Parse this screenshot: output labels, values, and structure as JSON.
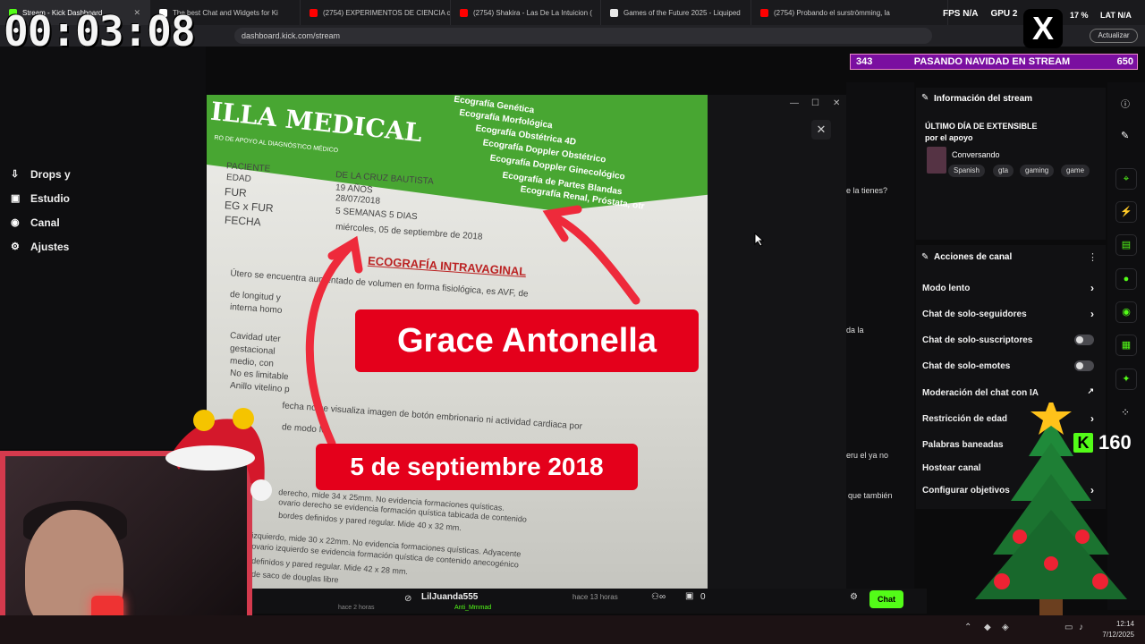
{
  "tabs": [
    {
      "label": "Stream - Kick Dashboard",
      "color": "#53fc18",
      "active": true
    },
    {
      "label": "The best Chat and Widgets for Ki",
      "color": "#ffffff"
    },
    {
      "label": "(2754) EXPERIMENTOS DE CIENCIA c",
      "color": "#ff0000"
    },
    {
      "label": "(2754) Shakira - Las De La Intuicion (",
      "color": "#ff0000"
    },
    {
      "label": "Games of the Future 2025 - Liquiped",
      "color": "#e8e8e8"
    },
    {
      "label": "(2754) Probando el surströmming, la",
      "color": "#ff0000"
    }
  ],
  "address": "dashboard.kick.com/stream",
  "update_label": "Actualizar",
  "timer": "00:03:08",
  "stats": {
    "fps_label": "FPS",
    "fps_value": "N/A",
    "gpu_label": "GPU",
    "gpu_value": "2",
    "load_value": "17 %",
    "lat_label": "LAT",
    "lat_value": "N/A"
  },
  "x_logo": "X",
  "left_nav": [
    {
      "label": "Drops y",
      "icon": "drops-icon"
    },
    {
      "label": "Estudio",
      "icon": "studio-icon"
    },
    {
      "label": "Canal",
      "icon": "channel-icon"
    },
    {
      "label": "Ajustes",
      "icon": "settings-icon"
    }
  ],
  "photo": {
    "clinic_name": "ILLA MEDICAL",
    "clinic_sub": "RO DE APOYO AL DIAGNÓSTICO MÉDICO",
    "services": [
      "Ecografía Genética",
      "Ecografía Morfológica",
      "Ecografía Obstétrica 4D",
      "Ecografía Doppler Obstétrico",
      "Ecografía Doppler Ginecológico",
      "Ecografía de Partes Blandas",
      "Ecografía Renal, Próstata, otr"
    ],
    "fields": [
      "PACIENTE",
      "EDAD",
      "FUR",
      "EG x FUR",
      "FECHA"
    ],
    "values": [
      "DE LA CRUZ BAUTISTA",
      "19 AÑOS",
      "28/07/2018",
      "5 SEMANAS 5 DIAS",
      "miércoles, 05 de septiembre de 2018"
    ],
    "exam_title": "ECOGRAFÍA INTRAVAGINAL",
    "body_lines": [
      "Útero se encuentra aumentado de volumen en forma fisiológica, es AVF, de",
      "de longitud y",
      "interna homo",
      "Cavidad uter",
      "gestacional",
      "medio, con",
      "No es limitable",
      "Anillo vitelino p",
      "fecha no se visualiza imagen de botón embrionario ni actividad cardiaca por",
      "de modo M",
      "derecho, mide 34 x 25mm. No evidencia formaciones quísticas.",
      "ovario derecho se evidencia formación quística tabicada de contenido",
      "bordes definidos y pared regular. Mide 40 x 32 mm.",
      "izquierdo, mide 30 x 22mm. No evidencia formaciones quísticas. Adyacente",
      "ovario izquierdo se evidencia formación quística de contenido anecogénico",
      "definidos y pared regular. Mide 42 x 28 mm.",
      "de saco de douglas libre"
    ],
    "banner_name": "Grace Antonella",
    "banner_date": "5 de septiembre 2018"
  },
  "modal_close": "✕",
  "chat_snippets": [
    "e la tienes?",
    "da la",
    "eru el ya no",
    "que también"
  ],
  "viewer_banner": {
    "left": "343",
    "title": "PASANDO NAVIDAD EN STREAM",
    "right": "650"
  },
  "info_panel": {
    "title": "Información del stream",
    "line1": "ÚLTIMO DÍA DE EXTENSIBLE",
    "line2": "por el apoyo",
    "category": "Conversando",
    "tags": [
      "Spanish",
      "gta",
      "gaming",
      "game"
    ]
  },
  "actions": {
    "title": "Acciones de canal",
    "rows": [
      {
        "label": "Modo lento",
        "control": "chevron"
      },
      {
        "label": "Chat de solo-seguidores",
        "control": "chevron"
      },
      {
        "label": "Chat de solo-suscriptores",
        "control": "toggle"
      },
      {
        "label": "Chat de solo-emotes",
        "control": "toggle"
      },
      {
        "label": "Moderación del chat con IA",
        "control": "external"
      },
      {
        "label": "Restricción de edad",
        "control": "chevron"
      },
      {
        "label": "Palabras baneadas",
        "control": "none"
      },
      {
        "label": "Hostear canal",
        "control": "none"
      },
      {
        "label": "Configurar objetivos",
        "control": "chevron"
      }
    ]
  },
  "kick_counter": {
    "logo": "K",
    "value": "160"
  },
  "bottom_bar": {
    "user": "LilJuanda555",
    "time": "hace 13 horas",
    "count": "0",
    "chat_label": "Chat",
    "prev_time": "hace 2 horas",
    "prev_user": "Anti_Mmmad"
  },
  "taskbar": {
    "time": "12:14",
    "date": "7/12/2025"
  },
  "colors": {
    "kick_green": "#53fc18",
    "banner_red": "#e4001b",
    "purple": "#7a0fa0"
  }
}
